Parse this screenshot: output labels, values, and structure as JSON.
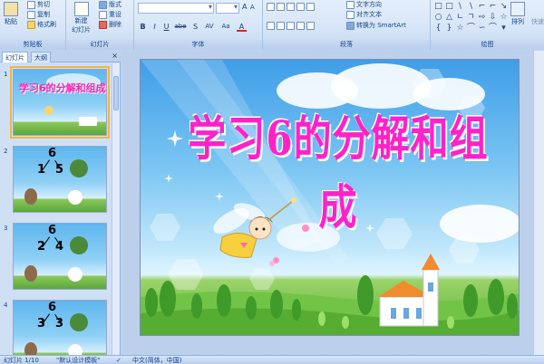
{
  "ribbon": {
    "clipboard": {
      "paste": "粘贴",
      "cut": "剪切",
      "copy": "复制",
      "format_painter": "格式刷",
      "label": "剪贴板"
    },
    "slides": {
      "new_slide": "新建",
      "new_slide_2": "幻灯片",
      "layout": "版式",
      "reset": "重设",
      "delete": "删除",
      "label": "幻灯片"
    },
    "font": {
      "bold": "B",
      "italic": "I",
      "underline": "U",
      "strike": "abe",
      "shadow": "S",
      "spacing": "AV",
      "case": "Aa",
      "label": "字体"
    },
    "paragraph": {
      "text_direction": "文字方向",
      "align_text": "对齐文本",
      "smartart": "转换为 SmartArt",
      "label": "段落"
    },
    "drawing": {
      "arrange": "排列",
      "quick_styles": "快速",
      "label": "绘图"
    }
  },
  "outline_pane": {
    "tab_slides": "幻灯片",
    "tab_outline": "大纲",
    "close": "×",
    "thumbnails": [
      {
        "num": "1",
        "title": "学习6的分解和组成"
      },
      {
        "num": "2",
        "top": "6",
        "left": "1",
        "right": "5"
      },
      {
        "num": "3",
        "top": "6",
        "left": "2",
        "right": "4"
      },
      {
        "num": "4",
        "top": "6",
        "left": "3",
        "right": "3"
      }
    ]
  },
  "slide": {
    "title": "学习6的分解和组成"
  },
  "statusbar": {
    "slide_info": "幻灯片 1/10",
    "theme": "\"默认设计模板\"",
    "language": "中文(简体，中国)"
  },
  "colors": {
    "title_pink": "#ff22c8",
    "sky": "#5eb6ee",
    "grass": "#5eb43a"
  }
}
